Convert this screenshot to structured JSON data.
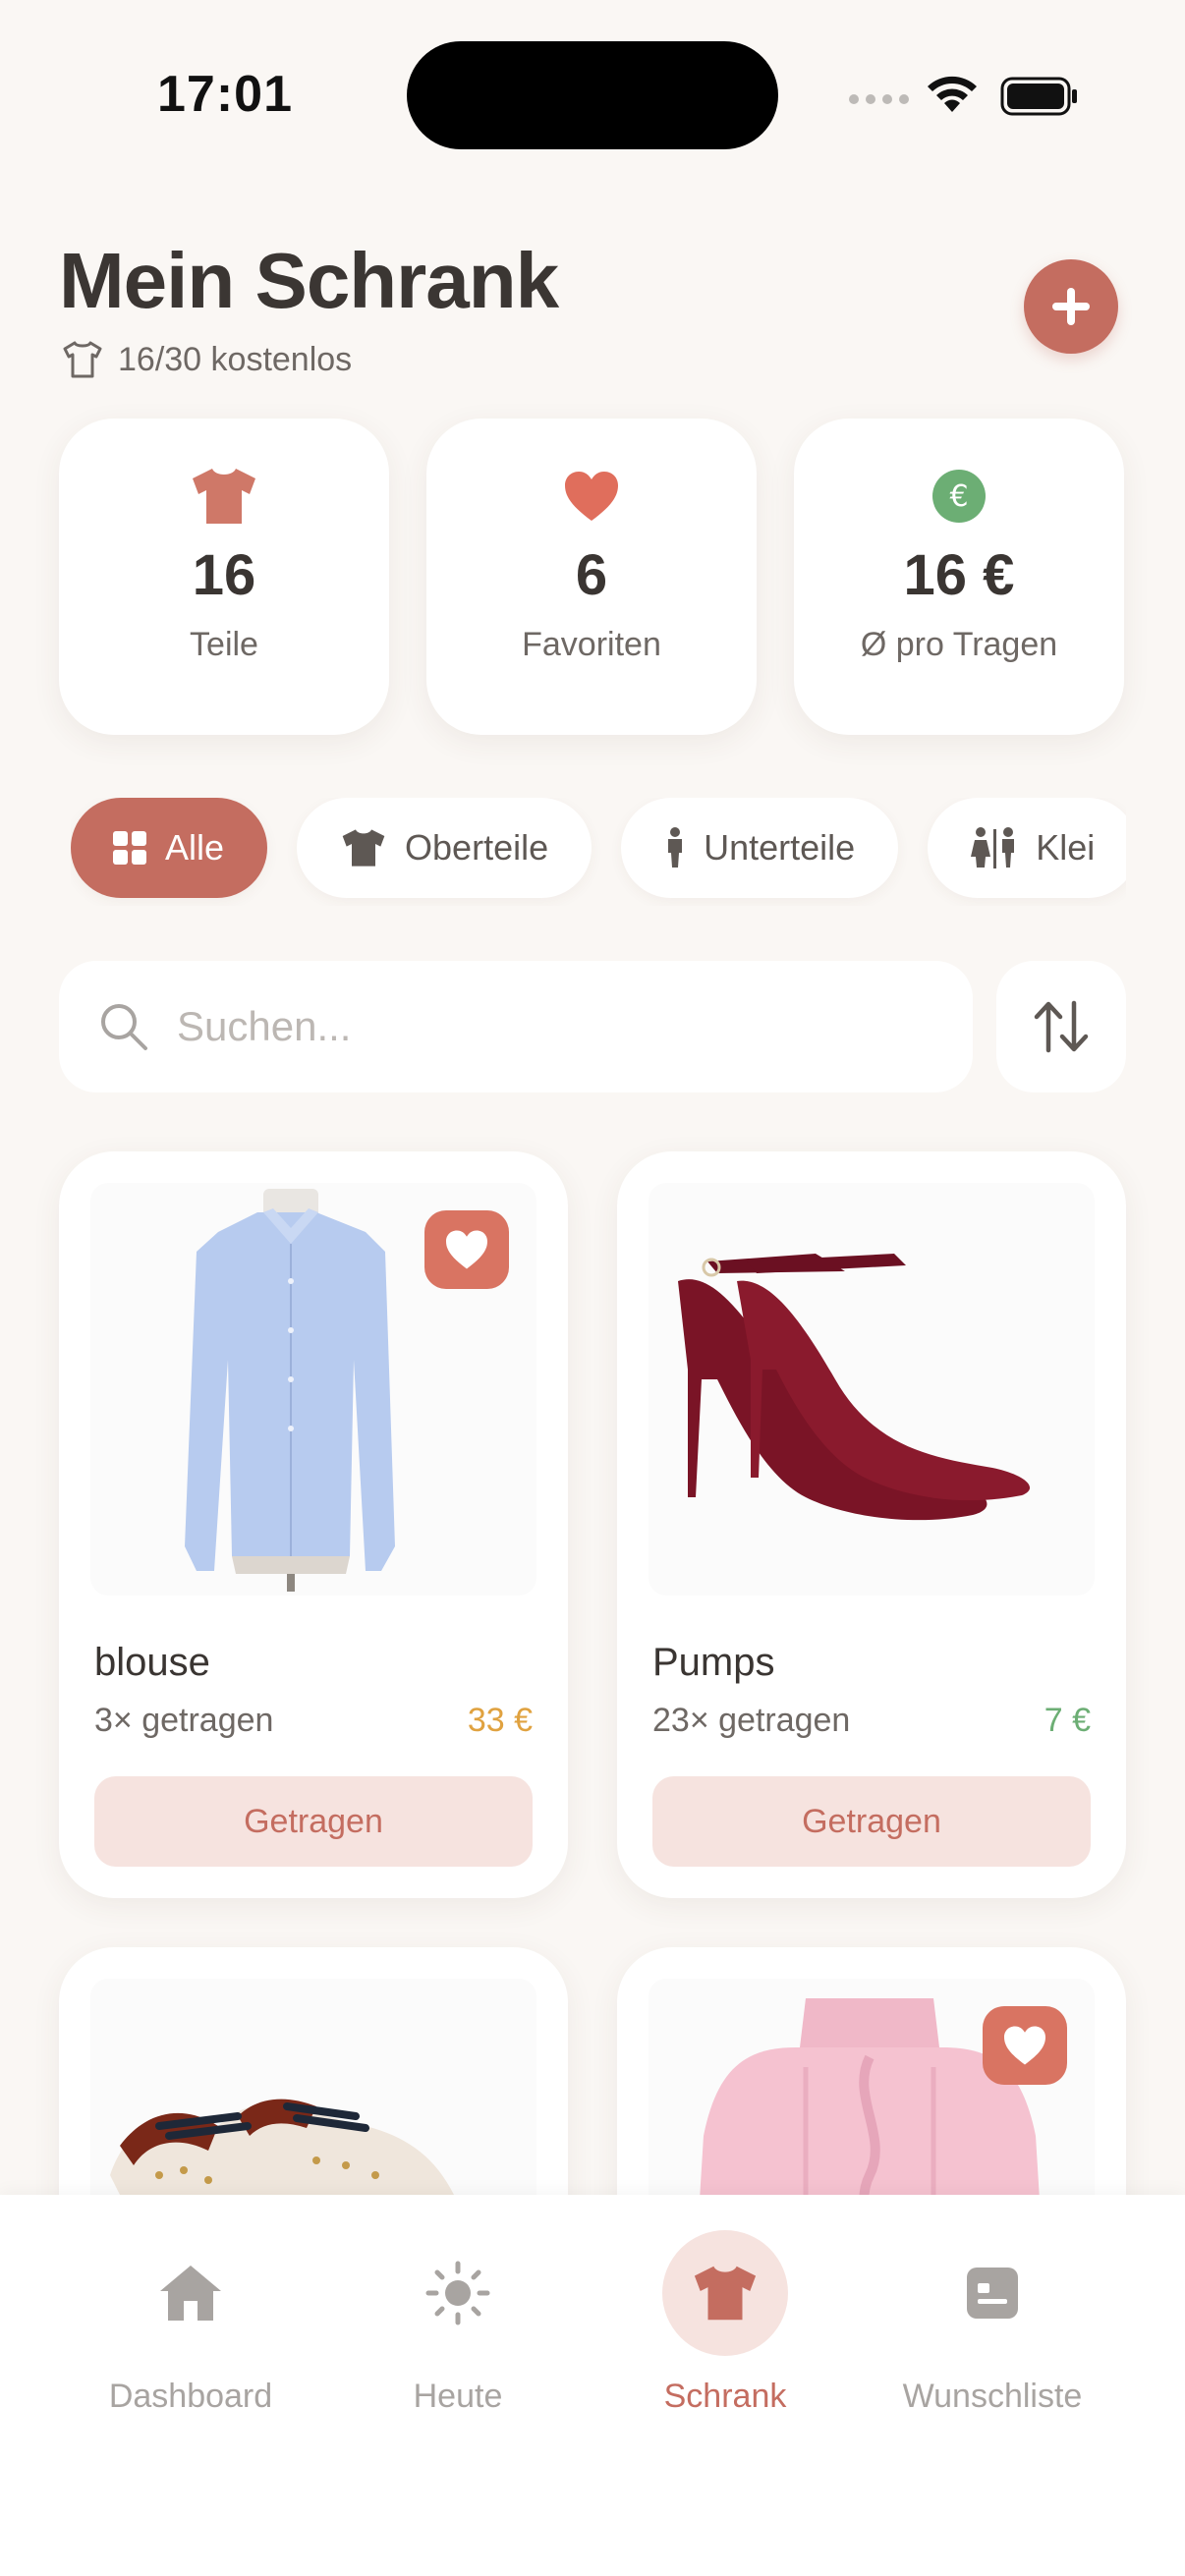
{
  "status_bar": {
    "time": "17:01"
  },
  "header": {
    "title": "Mein Schrank",
    "subtitle": "16/30 kostenlos",
    "add_icon": "plus-icon"
  },
  "stats": [
    {
      "icon": "shirt-icon",
      "value": "16",
      "label": "Teile"
    },
    {
      "icon": "heart-icon",
      "value": "6",
      "label": "Favoriten"
    },
    {
      "icon": "euro-icon",
      "value": "16 €",
      "label": "Ø pro Tragen"
    }
  ],
  "filters": [
    {
      "label": "Alle",
      "icon": "grid-icon",
      "active": true
    },
    {
      "label": "Oberteile",
      "icon": "shirt-icon",
      "active": false
    },
    {
      "label": "Unterteile",
      "icon": "person-icon",
      "active": false
    },
    {
      "label": "Klei",
      "icon": "people-icon",
      "active": false
    }
  ],
  "search": {
    "placeholder": "Suchen..."
  },
  "items": [
    {
      "name": "blouse",
      "worn": "3× getragen",
      "price": "33 €",
      "favorite": true,
      "button": "Getragen",
      "image": "blouse"
    },
    {
      "name": "Pumps",
      "worn": "23× getragen",
      "price": "7 €",
      "favorite": false,
      "button": "Getragen",
      "image": "pumps"
    },
    {
      "name": "",
      "worn": "",
      "price": "",
      "favorite": false,
      "button": "",
      "image": "sneakers"
    },
    {
      "name": "",
      "worn": "",
      "price": "",
      "favorite": true,
      "button": "",
      "image": "sweater"
    }
  ],
  "tabbar": [
    {
      "label": "Dashboard",
      "icon": "home-icon",
      "active": false
    },
    {
      "label": "Heute",
      "icon": "sun-icon",
      "active": false
    },
    {
      "label": "Schrank",
      "icon": "shirt-icon",
      "active": true
    },
    {
      "label": "Wunschliste",
      "icon": "list-icon",
      "active": false
    }
  ],
  "colors": {
    "accent": "#c46d60",
    "background": "#faf7f4",
    "favorite": "#d97462",
    "price_orange": "#e0a240",
    "price_green": "#6cae74"
  }
}
